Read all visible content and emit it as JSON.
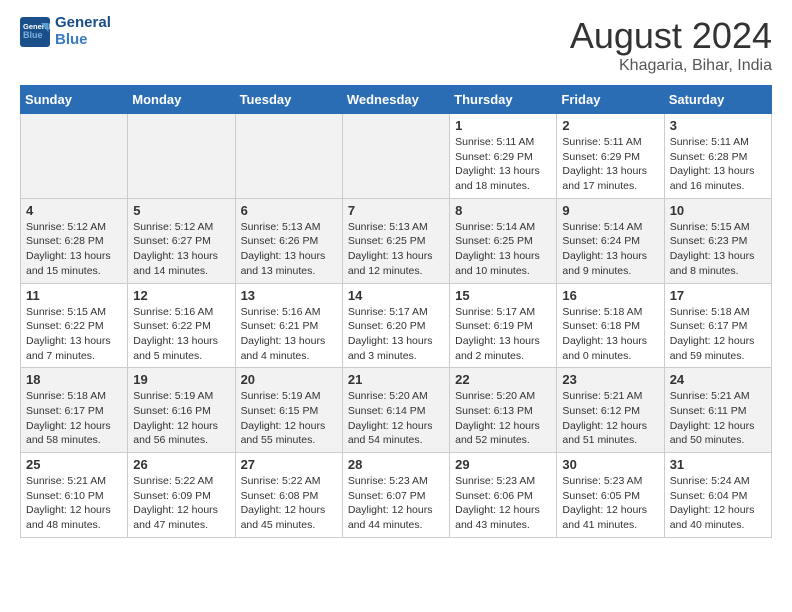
{
  "header": {
    "logo_line1": "General",
    "logo_line2": "Blue",
    "month_year": "August 2024",
    "location": "Khagaria, Bihar, India"
  },
  "days_of_week": [
    "Sunday",
    "Monday",
    "Tuesday",
    "Wednesday",
    "Thursday",
    "Friday",
    "Saturday"
  ],
  "weeks": [
    [
      {
        "day": "",
        "info": ""
      },
      {
        "day": "",
        "info": ""
      },
      {
        "day": "",
        "info": ""
      },
      {
        "day": "",
        "info": ""
      },
      {
        "day": "1",
        "info": "Sunrise: 5:11 AM\nSunset: 6:29 PM\nDaylight: 13 hours\nand 18 minutes."
      },
      {
        "day": "2",
        "info": "Sunrise: 5:11 AM\nSunset: 6:29 PM\nDaylight: 13 hours\nand 17 minutes."
      },
      {
        "day": "3",
        "info": "Sunrise: 5:11 AM\nSunset: 6:28 PM\nDaylight: 13 hours\nand 16 minutes."
      }
    ],
    [
      {
        "day": "4",
        "info": "Sunrise: 5:12 AM\nSunset: 6:28 PM\nDaylight: 13 hours\nand 15 minutes."
      },
      {
        "day": "5",
        "info": "Sunrise: 5:12 AM\nSunset: 6:27 PM\nDaylight: 13 hours\nand 14 minutes."
      },
      {
        "day": "6",
        "info": "Sunrise: 5:13 AM\nSunset: 6:26 PM\nDaylight: 13 hours\nand 13 minutes."
      },
      {
        "day": "7",
        "info": "Sunrise: 5:13 AM\nSunset: 6:25 PM\nDaylight: 13 hours\nand 12 minutes."
      },
      {
        "day": "8",
        "info": "Sunrise: 5:14 AM\nSunset: 6:25 PM\nDaylight: 13 hours\nand 10 minutes."
      },
      {
        "day": "9",
        "info": "Sunrise: 5:14 AM\nSunset: 6:24 PM\nDaylight: 13 hours\nand 9 minutes."
      },
      {
        "day": "10",
        "info": "Sunrise: 5:15 AM\nSunset: 6:23 PM\nDaylight: 13 hours\nand 8 minutes."
      }
    ],
    [
      {
        "day": "11",
        "info": "Sunrise: 5:15 AM\nSunset: 6:22 PM\nDaylight: 13 hours\nand 7 minutes."
      },
      {
        "day": "12",
        "info": "Sunrise: 5:16 AM\nSunset: 6:22 PM\nDaylight: 13 hours\nand 5 minutes."
      },
      {
        "day": "13",
        "info": "Sunrise: 5:16 AM\nSunset: 6:21 PM\nDaylight: 13 hours\nand 4 minutes."
      },
      {
        "day": "14",
        "info": "Sunrise: 5:17 AM\nSunset: 6:20 PM\nDaylight: 13 hours\nand 3 minutes."
      },
      {
        "day": "15",
        "info": "Sunrise: 5:17 AM\nSunset: 6:19 PM\nDaylight: 13 hours\nand 2 minutes."
      },
      {
        "day": "16",
        "info": "Sunrise: 5:18 AM\nSunset: 6:18 PM\nDaylight: 13 hours\nand 0 minutes."
      },
      {
        "day": "17",
        "info": "Sunrise: 5:18 AM\nSunset: 6:17 PM\nDaylight: 12 hours\nand 59 minutes."
      }
    ],
    [
      {
        "day": "18",
        "info": "Sunrise: 5:18 AM\nSunset: 6:17 PM\nDaylight: 12 hours\nand 58 minutes."
      },
      {
        "day": "19",
        "info": "Sunrise: 5:19 AM\nSunset: 6:16 PM\nDaylight: 12 hours\nand 56 minutes."
      },
      {
        "day": "20",
        "info": "Sunrise: 5:19 AM\nSunset: 6:15 PM\nDaylight: 12 hours\nand 55 minutes."
      },
      {
        "day": "21",
        "info": "Sunrise: 5:20 AM\nSunset: 6:14 PM\nDaylight: 12 hours\nand 54 minutes."
      },
      {
        "day": "22",
        "info": "Sunrise: 5:20 AM\nSunset: 6:13 PM\nDaylight: 12 hours\nand 52 minutes."
      },
      {
        "day": "23",
        "info": "Sunrise: 5:21 AM\nSunset: 6:12 PM\nDaylight: 12 hours\nand 51 minutes."
      },
      {
        "day": "24",
        "info": "Sunrise: 5:21 AM\nSunset: 6:11 PM\nDaylight: 12 hours\nand 50 minutes."
      }
    ],
    [
      {
        "day": "25",
        "info": "Sunrise: 5:21 AM\nSunset: 6:10 PM\nDaylight: 12 hours\nand 48 minutes."
      },
      {
        "day": "26",
        "info": "Sunrise: 5:22 AM\nSunset: 6:09 PM\nDaylight: 12 hours\nand 47 minutes."
      },
      {
        "day": "27",
        "info": "Sunrise: 5:22 AM\nSunset: 6:08 PM\nDaylight: 12 hours\nand 45 minutes."
      },
      {
        "day": "28",
        "info": "Sunrise: 5:23 AM\nSunset: 6:07 PM\nDaylight: 12 hours\nand 44 minutes."
      },
      {
        "day": "29",
        "info": "Sunrise: 5:23 AM\nSunset: 6:06 PM\nDaylight: 12 hours\nand 43 minutes."
      },
      {
        "day": "30",
        "info": "Sunrise: 5:23 AM\nSunset: 6:05 PM\nDaylight: 12 hours\nand 41 minutes."
      },
      {
        "day": "31",
        "info": "Sunrise: 5:24 AM\nSunset: 6:04 PM\nDaylight: 12 hours\nand 40 minutes."
      }
    ]
  ]
}
